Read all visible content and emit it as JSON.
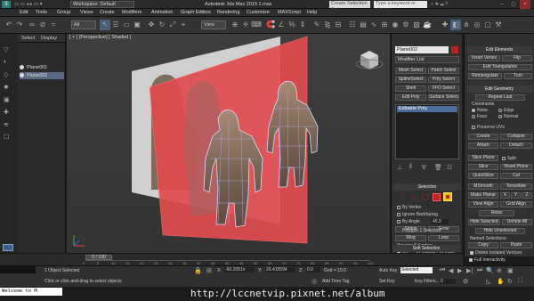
{
  "titlebar": {
    "workspace": "Workspace: Default",
    "title": "Autodesk 3ds Max  2015    1.max",
    "search_placeholder": "Type a keyword or phrase",
    "quick_select": "Create Selection Set"
  },
  "menu": [
    "Edit",
    "Tools",
    "Group",
    "Views",
    "Create",
    "Modifiers",
    "Animation",
    "Graph Editors",
    "Rendering",
    "Customize",
    "MAXScript",
    "Help"
  ],
  "toolbar": {
    "filter": "All",
    "coord": "View"
  },
  "scene_explorer": {
    "tabs": [
      "Select",
      "Display"
    ],
    "items": [
      "Plane001",
      "Plane002"
    ],
    "selected": "Plane002"
  },
  "viewport": {
    "label": "[ + ] [Perspective] [ Shaded ]"
  },
  "command_panel": {
    "object_name": "Plane002",
    "modifier_list": "Modifier List",
    "buttons": [
      "Mesh Select",
      "Patch Select",
      "SplineSelect",
      "Poly Select",
      "Shell",
      "FFD Select",
      "Edit Poly",
      "Surface Select"
    ],
    "stack_item": "Editable Poly",
    "selection": {
      "header": "Selection",
      "by_vertex": "By Vertex",
      "ignore_backfacing": "Ignore Backfacing",
      "by_angle": "By Angle",
      "angle_value": "45.0",
      "shrink": "Shrink",
      "grow": "Grow",
      "ring": "Ring",
      "loop": "Loop",
      "preview": "Preview Selection",
      "preview_opts": [
        "Off",
        "SubObj",
        "Multi"
      ],
      "status": "Polygon 1 Selected"
    },
    "soft_selection": "Soft Selection"
  },
  "right_panel": {
    "edit_elements": "Edit Elements",
    "insert_vertex": "Insert Vertex",
    "flip": "Flip",
    "edit_triangulation": "Edit Triangulation",
    "retriangulate": "Retriangulate",
    "turn": "Turn",
    "edit_geometry": "Edit Geometry",
    "repeat_last": "Repeat Last",
    "constraints": "Constraints",
    "constraint_opts": [
      "None",
      "Edge",
      "Face",
      "Normal"
    ],
    "preserve_uvs": "Preserve UVs",
    "create": "Create",
    "collapse": "Collapse",
    "attach": "Attach",
    "detach": "Detach",
    "slice_plane": "Slice Plane",
    "split": "Split",
    "slice": "Slice",
    "reset_plane": "Reset Plane",
    "quickslice": "QuickSlice",
    "cut": "Cut",
    "msmooth": "MSmooth",
    "tessellate": "Tessellate",
    "make_planar": "Make Planar",
    "xyz": [
      "X",
      "Y",
      "Z"
    ],
    "view_align": "View Align",
    "grid_align": "Grid Align",
    "relax": "Relax",
    "hide_selected": "Hide Selected",
    "unhide_all": "Unhide All",
    "hide_unselected": "Hide Unselected",
    "named_selections": "Named Selections:",
    "copy": "Copy",
    "paste": "Paste",
    "delete_isolated": "Delete Isolated Vertices",
    "full_interactivity": "Full Interactivity"
  },
  "timeline": {
    "frame": "0 / 100",
    "ticks": [
      "0",
      "5",
      "10",
      "15",
      "20",
      "25",
      "30",
      "35",
      "40",
      "45",
      "50",
      "55",
      "60",
      "65",
      "70",
      "75",
      "80",
      "85",
      "90",
      "95",
      "100"
    ]
  },
  "status": {
    "selected": "1 Object Selected",
    "prompt": "Click or click-and-drag to select objects",
    "x_label": "X:",
    "x": "-90.2051n",
    "y_label": "Y:",
    "y": "26.415594",
    "z_label": "Z:",
    "z": "0.0",
    "grid": "Grid = 10.0",
    "add_time_tag": "Add Time Tag",
    "auto_key": "Auto Key",
    "set_key": "Set Key",
    "selected_dropdown": "Selected",
    "key_filters": "Key Filters...",
    "frame_num": "0"
  },
  "maxscript": "Welcome to M",
  "watermark_url": "http://lccnetvip.pixnet.net/album",
  "colors": {
    "accent": "#f2c200",
    "selected_red": "#ff3030",
    "plane_red": "#e8484a"
  }
}
